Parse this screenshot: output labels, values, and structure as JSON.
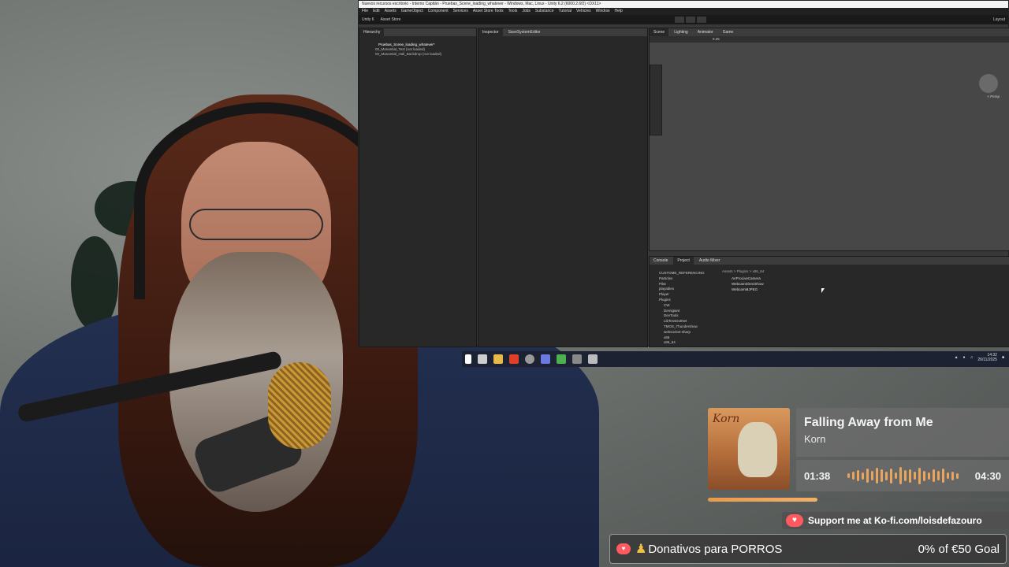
{
  "unity": {
    "title_bar": "Nuevos recursos escritorio - Interno Capitán - Pruebas_Scene_loading_whatever - Windows, Mac, Linux - Unity 6.2 (6000.2.6f2) <DX11>",
    "menu": [
      "File",
      "Edit",
      "Assets",
      "GameObject",
      "Component",
      "Services",
      "Asset Store Tools",
      "Tools",
      "Jobs",
      "Substance",
      "Tutorial",
      "Vehicles",
      "Window",
      "Help"
    ],
    "toolbar_account": "Unity 6",
    "toolbar_asset_store": "Asset Store",
    "layout_label": "Layout",
    "tabs_left": [
      "Hierarchy"
    ],
    "tabs_inspector": [
      "Inspector",
      "SaveSystemEditor"
    ],
    "tabs_scene": [
      "Scene",
      "Lighting",
      "Animator",
      "Game"
    ],
    "tabs_bottom": [
      "Console",
      "Project",
      "Audio Mixer"
    ],
    "scene_zoom": "0.25",
    "persp_label": "< Persp",
    "hierarchy": {
      "scene": "Pruebas_Scene_loading_whatever*",
      "items": [
        "00_Manantial_Test (not loaded)",
        "00_Manantial_Hall_Backdrop (not loaded)"
      ]
    },
    "project_folders": [
      "CUSTOME_REFERENCING",
      "Particles",
      "Pilar",
      "playables",
      "Player",
      "Plugins",
      "CW",
      "Demigiant",
      "DevTools",
      "LibTessDotNet",
      "TMOS_Thundershow",
      "websocket-sharp",
      "x86",
      "x86_64"
    ],
    "breadcrumb": "Assets > Plugins > x86_64",
    "assets": [
      "AVProLiveCamera",
      "WebcamDirectShow",
      "WebcamMJPEG"
    ]
  },
  "taskbar": {
    "time": "14:32",
    "date": "26/11/2025"
  },
  "now_playing": {
    "title": "Falling Away from Me",
    "artist": "Korn",
    "album_logo": "Korn",
    "elapsed": "01:38",
    "duration": "04:30",
    "progress": 0.363,
    "wave_heights": [
      6,
      10,
      14,
      9,
      18,
      12,
      20,
      16,
      11,
      19,
      8,
      22,
      14,
      17,
      10,
      21,
      13,
      9,
      16,
      12,
      18,
      8,
      11,
      7
    ],
    "accent": "#e8a55d"
  },
  "kofi": {
    "text": "Support me at Ko-fi.com/loisdefazouro",
    "accent": "#ff5a5f"
  },
  "goal": {
    "title": "Donativos para PORROS",
    "progress_text": "0% of €50 Goal",
    "percent": 0
  }
}
